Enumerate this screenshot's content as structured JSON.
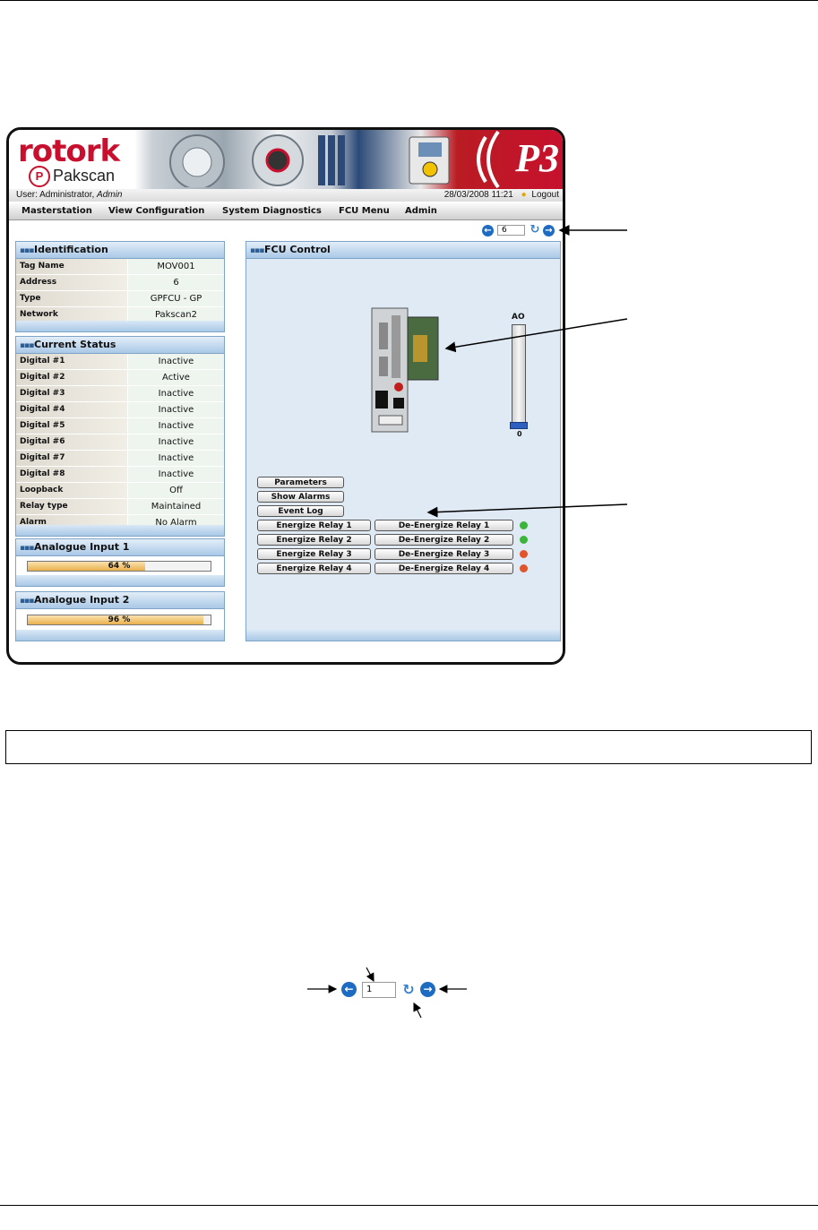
{
  "header": {
    "brand": "rotork",
    "product": "Pakscan",
    "product_badge": "P",
    "version_badge": "P3",
    "user_label": "User: Administrator,",
    "user_name": "Admin",
    "datetime": "28/03/2008 11:21",
    "logout": "Logout"
  },
  "menu": [
    "Masterstation",
    "View Configuration",
    "System Diagnostics",
    "FCU Menu",
    "Admin"
  ],
  "nav": {
    "value": "6"
  },
  "identification": {
    "title": "Identification",
    "rows": [
      {
        "k": "Tag Name",
        "v": "MOV001"
      },
      {
        "k": "Address",
        "v": "6"
      },
      {
        "k": "Type",
        "v": "GPFCU - GP"
      },
      {
        "k": "Network",
        "v": "Pakscan2"
      }
    ]
  },
  "current_status": {
    "title": "Current Status",
    "rows": [
      {
        "k": "Digital #1",
        "v": "Inactive"
      },
      {
        "k": "Digital #2",
        "v": "Active"
      },
      {
        "k": "Digital #3",
        "v": "Inactive"
      },
      {
        "k": "Digital #4",
        "v": "Inactive"
      },
      {
        "k": "Digital #5",
        "v": "Inactive"
      },
      {
        "k": "Digital #6",
        "v": "Inactive"
      },
      {
        "k": "Digital #7",
        "v": "Inactive"
      },
      {
        "k": "Digital #8",
        "v": "Inactive"
      },
      {
        "k": "Loopback",
        "v": "Off"
      },
      {
        "k": "Relay type",
        "v": "Maintained"
      },
      {
        "k": "Alarm",
        "v": "No Alarm"
      }
    ]
  },
  "analogue1": {
    "title": "Analogue Input 1",
    "text": "64 %",
    "value": 64
  },
  "analogue2": {
    "title": "Analogue Input 2",
    "text": "96 %",
    "value": 96
  },
  "fcu": {
    "title": "FCU Control",
    "ao_label": "AO",
    "ao_value": "0",
    "buttons": [
      "Parameters",
      "Show Alarms",
      "Event Log"
    ],
    "relays": [
      {
        "on": "Energize Relay 1",
        "off": "De-Energize Relay 1",
        "led": "#3cb43c"
      },
      {
        "on": "Energize Relay 2",
        "off": "De-Energize Relay 2",
        "led": "#3cb43c"
      },
      {
        "on": "Energize Relay 3",
        "off": "De-Energize Relay 3",
        "led": "#e0552c"
      },
      {
        "on": "Energize Relay 4",
        "off": "De-Energize Relay 4",
        "led": "#e0552c"
      }
    ]
  },
  "detail_nav": {
    "value": "1"
  },
  "colors": {
    "brand": "#c8102e",
    "panel_border": "#7ea4c8",
    "nav_blue": "#1e6bc2"
  }
}
